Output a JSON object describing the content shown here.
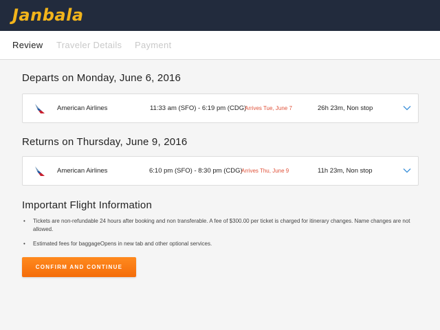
{
  "header": {
    "logo_text": "Janbala"
  },
  "steps": [
    {
      "label": "Review",
      "active": true
    },
    {
      "label": "Traveler Details",
      "active": false
    },
    {
      "label": "Payment",
      "active": false
    }
  ],
  "departure": {
    "title": "Departs on Monday, June 6, 2016",
    "airline": "American Airlines",
    "airline_icon": "american-airlines-logo-icon",
    "times": "11:33 am (SFO) - 6:19 pm (CDG)",
    "arrives": "Arrives Tue, June 7",
    "duration": "26h 23m, Non stop"
  },
  "return": {
    "title": "Returns on Thursday, June 9, 2016",
    "airline": "American Airlines",
    "airline_icon": "american-airlines-logo-icon",
    "times": "6:10 pm (SFO) - 8:30 pm (CDG)",
    "arrives": "Arrives Thu, June 9",
    "duration": "11h 23m, Non stop"
  },
  "info": {
    "title": "Important Flight Information",
    "items": [
      "Tickets are non-refundable 24 hours after booking and non transferable. A fee of $300.00 per ticket is charged for itinerary changes. Name changes are not allowed.",
      "Estimated fees for baggageOpens in new tab and other optional services."
    ]
  },
  "confirm_label": "CONFIRM AND CONTINUE",
  "colors": {
    "header_bg": "#222b3d",
    "logo": "#f2b41b",
    "accent_orange": "#f47b14",
    "arrives_red": "#e0533b",
    "chevron_blue": "#3a8fd9"
  }
}
